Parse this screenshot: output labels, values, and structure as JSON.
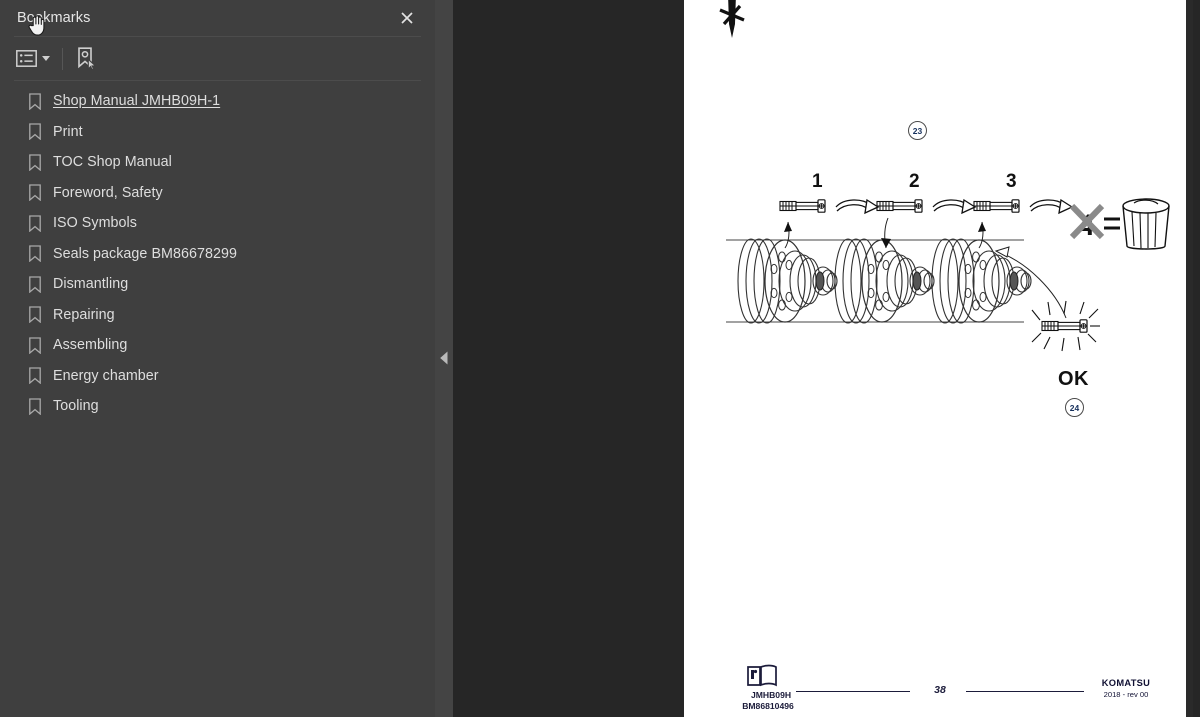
{
  "sidebar": {
    "title": "Bookmarks",
    "close_icon": "close-icon",
    "toolbar": {
      "options_icon": "list-options-icon",
      "options_caret_icon": "chevron-down-icon",
      "new_bookmark_icon": "new-bookmark-icon"
    },
    "items": [
      {
        "label": "Shop Manual JMHB09H-1",
        "active": true
      },
      {
        "label": "Print",
        "active": false
      },
      {
        "label": "TOC Shop Manual",
        "active": false
      },
      {
        "label": "Foreword, Safety",
        "active": false
      },
      {
        "label": "ISO Symbols",
        "active": false
      },
      {
        "label": "Seals package BM86678299",
        "active": false
      },
      {
        "label": "Dismantling",
        "active": false
      },
      {
        "label": "Repairing",
        "active": false
      },
      {
        "label": "Assembling",
        "active": false
      },
      {
        "label": "Energy chamber",
        "active": false
      },
      {
        "label": "Tooling",
        "active": false
      }
    ],
    "cursor_icon": "pointing-hand-cursor"
  },
  "splitter": {
    "collapse_icon": "collapse-left-triangle-icon"
  },
  "document": {
    "callouts": [
      {
        "id": "callout-23",
        "value": "23"
      },
      {
        "id": "callout-24",
        "value": "24"
      }
    ],
    "steps": [
      "1",
      "2",
      "3"
    ],
    "ok_label": "OK",
    "discard": {
      "strike_value": "4",
      "equals": "=",
      "bin_icon": "trash-bin-icon"
    },
    "top_tool_icon": "chisel-tool-icon",
    "footer": {
      "manual_icon": "open-manual-icon",
      "model": "JMHB09H",
      "code": "BM86810496",
      "page_number": "38",
      "brand": "KOMATSU",
      "revision": "2018 -  rev 00"
    }
  },
  "colors": {
    "sidebar_bg": "#3f3f3f",
    "viewer_bg": "#262626",
    "splitter_bg": "#444444",
    "page_bg": "#ffffff",
    "text": "#dedede",
    "callout_blue": "#16305c"
  }
}
